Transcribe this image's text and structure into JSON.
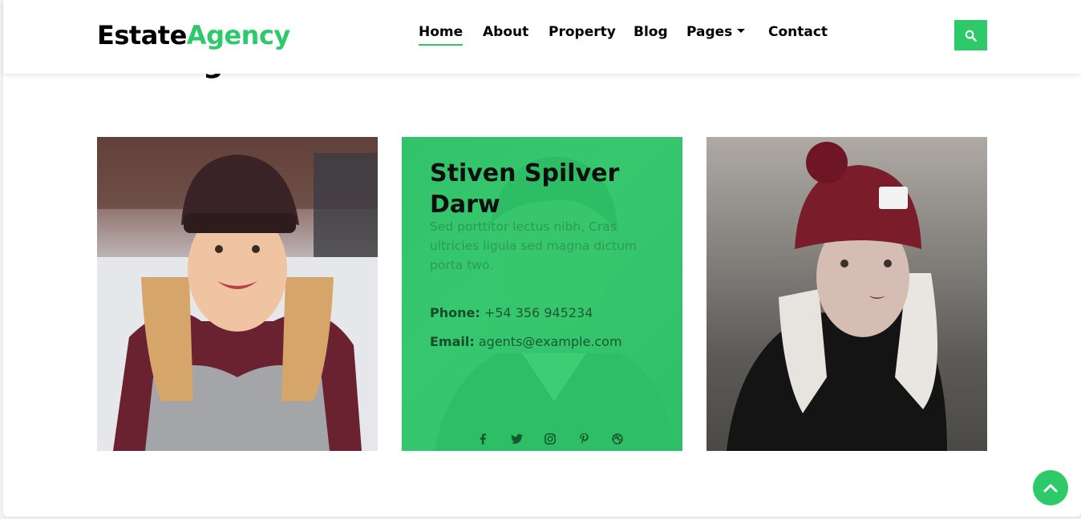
{
  "brand": {
    "part1": "Estate",
    "part2": "Agency"
  },
  "behind": {
    "glyph": "g",
    "crumb": "g"
  },
  "nav": {
    "items": [
      {
        "label": "Home",
        "active": true
      },
      {
        "label": "About",
        "active": false
      },
      {
        "label": "Property",
        "active": false
      },
      {
        "label": "Blog",
        "active": false
      },
      {
        "label": "Pages",
        "active": false,
        "dropdown": true
      },
      {
        "label": "Contact",
        "active": false
      }
    ]
  },
  "search": {
    "icon": "search-icon"
  },
  "agents": [
    {
      "photo": "woman-scarf-photo"
    },
    {
      "photo": "man-portrait-photo",
      "name": "Stiven Spilver Darw",
      "description": "Sed porttitor lectus nibh, Cras ultricies ligula sed magna dictum porta two.",
      "phone_label": "Phone:",
      "phone": "+54 356 945234",
      "email_label": "Email:",
      "email": "agents@example.com",
      "socials": [
        "facebook-icon",
        "twitter-icon",
        "instagram-icon",
        "pinterest-icon",
        "dribbble-icon"
      ]
    },
    {
      "photo": "woman-beanie-photo"
    }
  ],
  "back_to_top": {
    "icon": "chevron-up-icon"
  },
  "colors": {
    "accent": "#2eca6a",
    "text": "#000000",
    "background": "#ffffff"
  }
}
